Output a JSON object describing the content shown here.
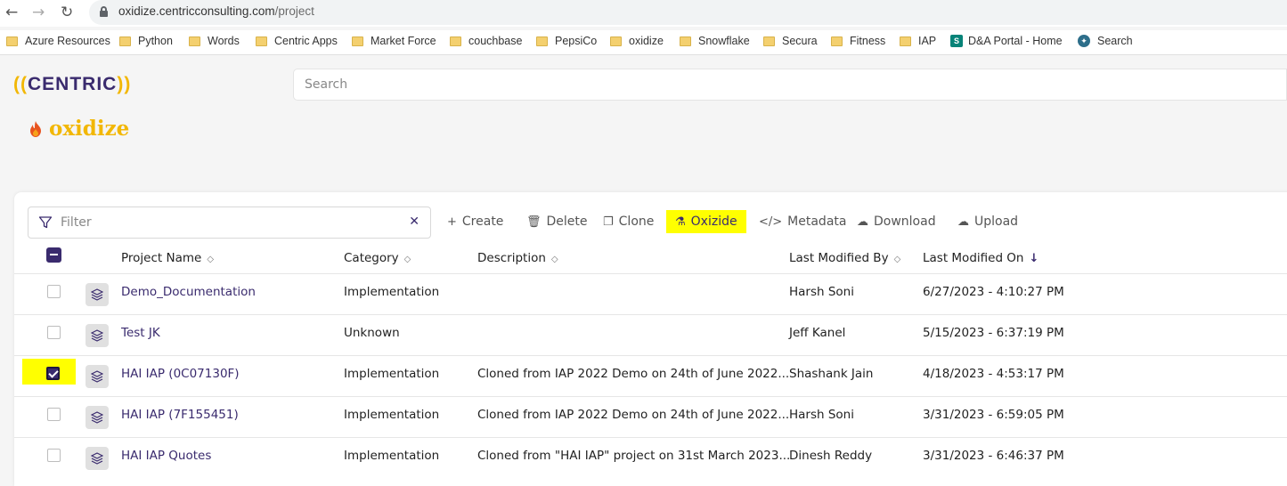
{
  "browser": {
    "url_domain": "oxidize.centricconsulting.com",
    "url_path": "/project",
    "bookmarks": [
      {
        "label": "Azure Resources",
        "icon": "folder-icon"
      },
      {
        "label": "Python",
        "icon": "folder-icon"
      },
      {
        "label": "Words",
        "icon": "folder-icon"
      },
      {
        "label": "Centric Apps",
        "icon": "folder-icon"
      },
      {
        "label": "Market Force",
        "icon": "folder-icon"
      },
      {
        "label": "couchbase",
        "icon": "folder-icon"
      },
      {
        "label": "PepsiCo",
        "icon": "folder-icon"
      },
      {
        "label": "oxidize",
        "icon": "folder-icon"
      },
      {
        "label": "Snowflake",
        "icon": "folder-icon"
      },
      {
        "label": "Secura",
        "icon": "folder-icon"
      },
      {
        "label": "Fitness",
        "icon": "folder-icon"
      },
      {
        "label": "IAP",
        "icon": "folder-icon"
      },
      {
        "label": "D&A Portal - Home",
        "icon": "sharepoint-icon"
      },
      {
        "label": "Search",
        "icon": "search-site-icon"
      }
    ]
  },
  "header": {
    "logo_left": "((",
    "logo_word": "CENTRIC",
    "logo_right": "))",
    "search_placeholder": "Search",
    "brand": "oxidize"
  },
  "toolbar": {
    "filter_placeholder": "Filter",
    "create": "Create",
    "delete": "Delete",
    "clone": "Clone",
    "oxidize": "Oxizide",
    "metadata": "Metadata",
    "download": "Download",
    "upload": "Upload"
  },
  "table": {
    "columns": [
      "Project Name",
      "Category",
      "Description",
      "Last Modified By",
      "Last Modified On"
    ],
    "rows": [
      {
        "name": "Demo_Documentation",
        "category": "Implementation",
        "description": "",
        "modified_by": "Harsh Soni",
        "modified_on": "6/27/2023 - 4:10:27 PM",
        "checked": false
      },
      {
        "name": "Test JK",
        "category": "Unknown",
        "description": "",
        "modified_by": "Jeff Kanel",
        "modified_on": "5/15/2023 - 6:37:19 PM",
        "checked": false
      },
      {
        "name": "HAI IAP (0C07130F)",
        "category": "Implementation",
        "description": "Cloned from IAP 2022 Demo on 24th of June 2022...",
        "modified_by": "Shashank Jain",
        "modified_on": "4/18/2023 - 4:53:17 PM",
        "checked": true
      },
      {
        "name": "HAI IAP (7F155451)",
        "category": "Implementation",
        "description": "Cloned from IAP 2022 Demo on 24th of June 2022...",
        "modified_by": "Harsh Soni",
        "modified_on": "3/31/2023 - 6:59:05 PM",
        "checked": false
      },
      {
        "name": "HAI IAP Quotes",
        "category": "Implementation",
        "description": "Cloned from \"HAI IAP\" project on 31st March 2023...",
        "modified_by": "Dinesh Reddy",
        "modified_on": "3/31/2023 - 6:46:37 PM",
        "checked": false
      }
    ]
  },
  "colors": {
    "accent": "#3a2b6e",
    "brand_yellow": "#f2b705",
    "highlight": "#ffff00"
  }
}
